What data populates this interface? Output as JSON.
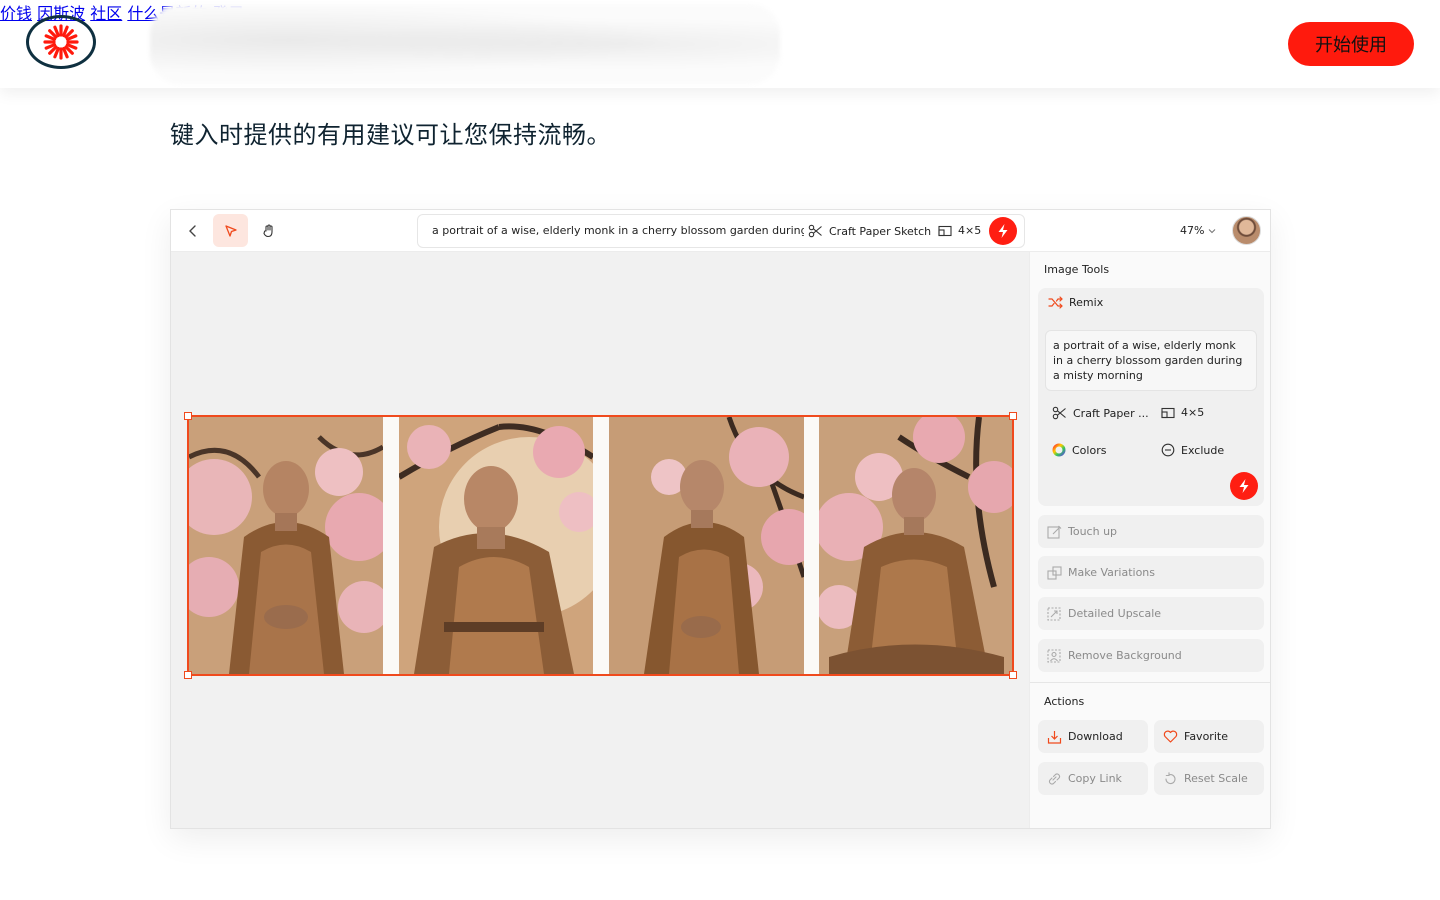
{
  "nav": {
    "links": [
      "价钱",
      "因斯波",
      "社区",
      "什么是新的",
      "登录"
    ],
    "cta_label": "开始使用"
  },
  "headline": "键入时提供的有用建议可让您保持流畅。",
  "app": {
    "toolbar": {
      "prompt": "a portrait of a wise, elderly monk in a cherry blossom garden during a misty morning",
      "style_label": "Craft Paper Sketch",
      "ratio_label": "4×5",
      "zoom_label": "47%"
    },
    "sidebar": {
      "image_tools_title": "Image Tools",
      "remix_label": "Remix",
      "remix_prompt": "a portrait of a wise, elderly monk in a cherry blossom garden during a misty morning",
      "style_short": "Craft Paper ...",
      "ratio_label": "4×5",
      "colors_label": "Colors",
      "exclude_label": "Exclude",
      "tools": [
        "Touch up",
        "Make Variations",
        "Detailed Upscale",
        "Remove Background"
      ],
      "actions_title": "Actions",
      "actions": {
        "download": "Download",
        "favorite": "Favorite",
        "copy_link": "Copy Link",
        "reset_scale": "Reset Scale"
      }
    }
  },
  "colors": {
    "accent": "#ff1a0d",
    "selection": "#f04a1d",
    "text_dark": "#0f2330"
  }
}
